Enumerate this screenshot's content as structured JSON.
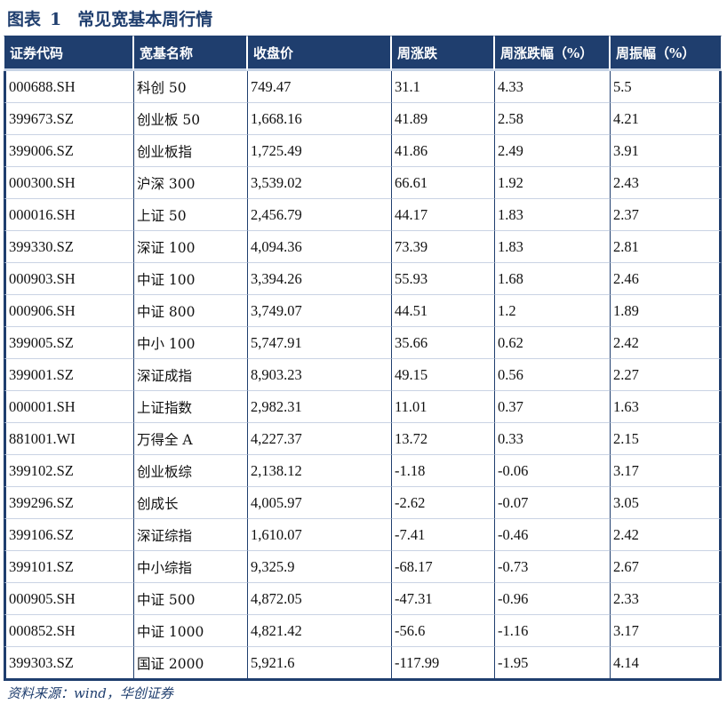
{
  "title": {
    "prefix": "图表",
    "number": "1",
    "text": "常见宽基本周行情"
  },
  "table": {
    "headers": [
      "证券代码",
      "宽基名称",
      "收盘价",
      "周涨跌",
      "周涨跌幅（%）",
      "周振幅（%）"
    ],
    "rows": [
      [
        "000688.SH",
        "科创 50",
        "749.47",
        "31.1",
        "4.33",
        "5.5"
      ],
      [
        "399673.SZ",
        "创业板 50",
        "1,668.16",
        "41.89",
        "2.58",
        "4.21"
      ],
      [
        "399006.SZ",
        "创业板指",
        "1,725.49",
        "41.86",
        "2.49",
        "3.91"
      ],
      [
        "000300.SH",
        "沪深 300",
        "3,539.02",
        "66.61",
        "1.92",
        "2.43"
      ],
      [
        "000016.SH",
        "上证 50",
        "2,456.79",
        "44.17",
        "1.83",
        "2.37"
      ],
      [
        "399330.SZ",
        "深证 100",
        "4,094.36",
        "73.39",
        "1.83",
        "2.81"
      ],
      [
        "000903.SH",
        "中证 100",
        "3,394.26",
        "55.93",
        "1.68",
        "2.46"
      ],
      [
        "000906.SH",
        "中证 800",
        "3,749.07",
        "44.51",
        "1.2",
        "1.89"
      ],
      [
        "399005.SZ",
        "中小 100",
        "5,747.91",
        "35.66",
        "0.62",
        "2.42"
      ],
      [
        "399001.SZ",
        "深证成指",
        "8,903.23",
        "49.15",
        "0.56",
        "2.27"
      ],
      [
        "000001.SH",
        "上证指数",
        "2,982.31",
        "11.01",
        "0.37",
        "1.63"
      ],
      [
        "881001.WI",
        "万得全 A",
        "4,227.37",
        "13.72",
        "0.33",
        "2.15"
      ],
      [
        "399102.SZ",
        "创业板综",
        "2,138.12",
        "-1.18",
        "-0.06",
        "3.17"
      ],
      [
        "399296.SZ",
        "创成长",
        "4,005.97",
        "-2.62",
        "-0.07",
        "3.05"
      ],
      [
        "399106.SZ",
        "深证综指",
        "1,610.07",
        "-7.41",
        "-0.46",
        "2.42"
      ],
      [
        "399101.SZ",
        "中小综指",
        "9,325.9",
        "-68.17",
        "-0.73",
        "2.67"
      ],
      [
        "000905.SH",
        "中证 500",
        "4,872.05",
        "-47.31",
        "-0.96",
        "2.33"
      ],
      [
        "000852.SH",
        "中证 1000",
        "4,821.42",
        "-56.6",
        "-1.16",
        "3.17"
      ],
      [
        "399303.SZ",
        "国证 2000",
        "5,921.6",
        "-117.99",
        "-1.95",
        "4.14"
      ]
    ]
  },
  "source": "资料来源：wind，华创证券",
  "colors": {
    "header_bg": "#1f3e6e",
    "title": "#1f3e6e",
    "row_rule": "#c9d3e3"
  }
}
